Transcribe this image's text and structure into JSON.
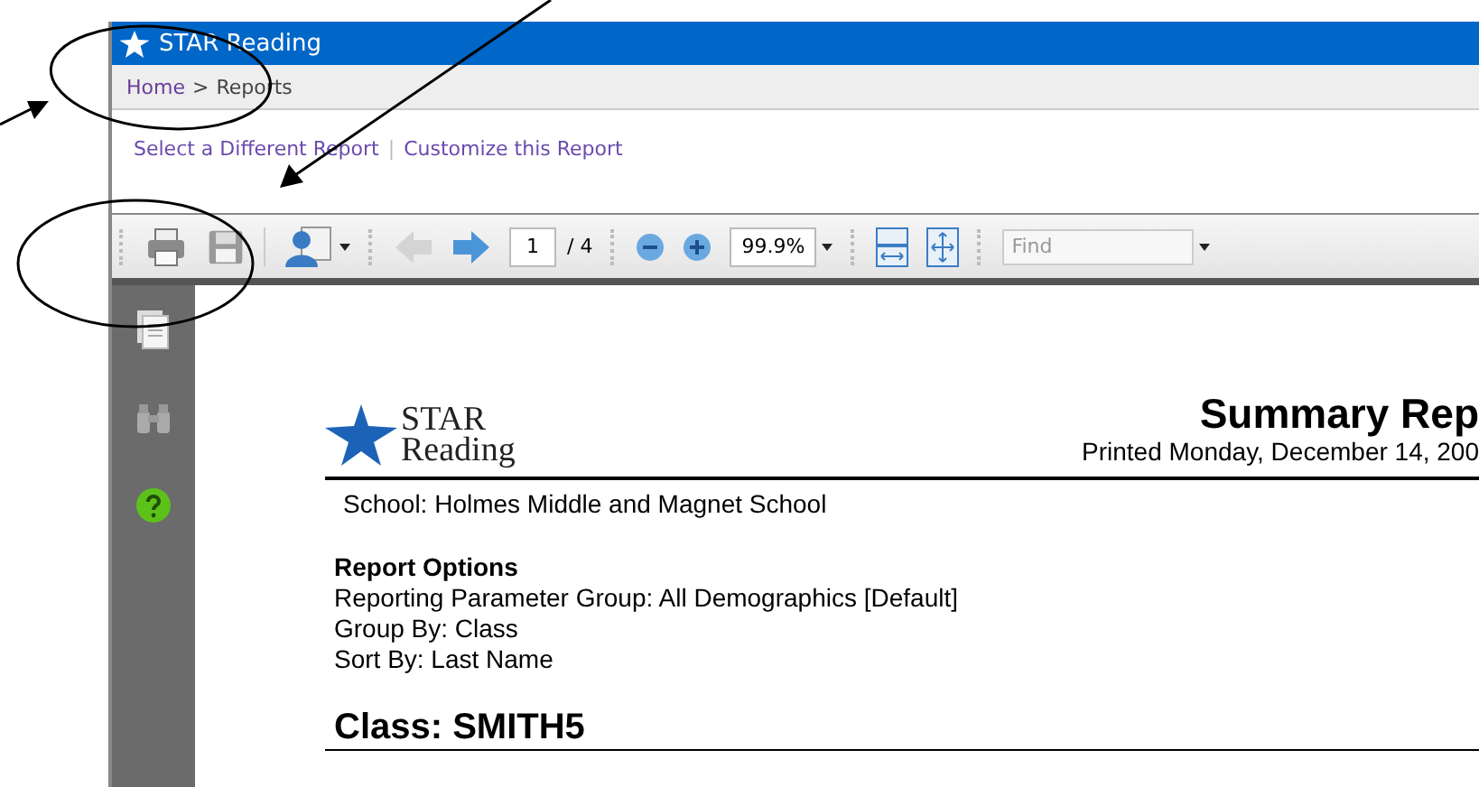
{
  "app": {
    "title": "STAR Reading"
  },
  "breadcrumb": {
    "home": "Home",
    "separator": ">",
    "current": "Reports"
  },
  "links": [
    "Select a Different Report",
    "Customize this Report"
  ],
  "link_separator": "|",
  "toolbar": {
    "back_disabled": true,
    "forward_disabled": false,
    "page": "1",
    "page_total": "/ 4",
    "zoom": "99.9%",
    "find_placeholder": "Find"
  },
  "report": {
    "logo_line1": "STAR",
    "logo_line2": "Reading",
    "title": "Summary Rep",
    "printed": "Printed Monday, December 14, 200",
    "school": "School: Holmes Middle and Magnet School",
    "options_heading": "Report Options",
    "options": [
      "Reporting Parameter Group: All Demographics [Default]",
      "Group By: Class",
      "Sort By: Last Name"
    ],
    "class_heading": "Class: SMITH5"
  }
}
